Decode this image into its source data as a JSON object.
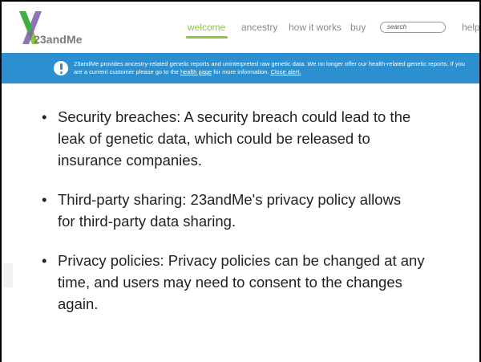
{
  "header": {
    "logo_text": "23andMe",
    "nav": [
      {
        "label": "welcome",
        "active": true
      },
      {
        "label": "ancestry",
        "active": false
      },
      {
        "label": "how it works",
        "active": false
      },
      {
        "label": "buy",
        "active": false
      },
      {
        "label": "help",
        "active": false
      }
    ],
    "search_placeholder": "search"
  },
  "alert": {
    "text_before_link": "23andMe provides ancestry-related genetic reports and uninterpreted raw genetic data. We no longer offer our health-related genetic reports. If you are a current customer please go to the ",
    "health_link": "health page",
    "text_after_link": " for more information. ",
    "close_link": "Close alert."
  },
  "bullets": [
    "Security breaches: A security breach could lead to the leak of genetic data, which could be released to insurance companies.",
    "Third-party sharing: 23andMe's privacy policy allows for third-party data sharing.",
    "Privacy policies: Privacy policies can be changed at any time, and users may need to consent to the changes again."
  ],
  "colors": {
    "nav_active": "#8dc63f",
    "alert_bg": "#2b8fd0"
  }
}
